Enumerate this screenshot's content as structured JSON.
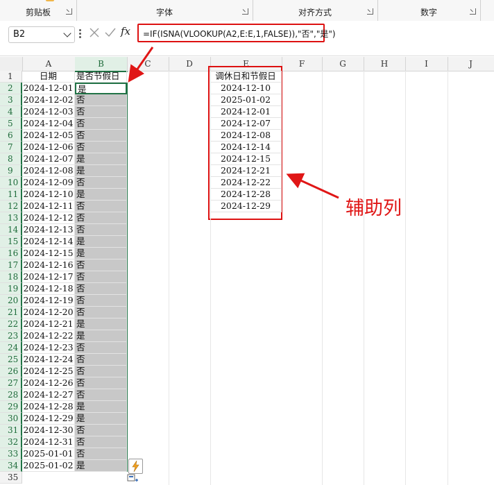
{
  "ribbon": {
    "groups": [
      "剪贴板",
      "字体",
      "对齐方式",
      "数字"
    ]
  },
  "formula_bar": {
    "name_box": "B2",
    "formula": "=IF(ISNA(VLOOKUP(A2,E:E,1,FALSE)),\"否\",\"是\")"
  },
  "columns": [
    "A",
    "B",
    "C",
    "D",
    "E",
    "F",
    "G",
    "H",
    "I",
    "J"
  ],
  "rows": [
    "1",
    "2",
    "3",
    "4",
    "5",
    "6",
    "7",
    "8",
    "9",
    "10",
    "11",
    "12",
    "13",
    "14",
    "15",
    "16",
    "17",
    "18",
    "19",
    "20",
    "21",
    "22",
    "23",
    "24",
    "25",
    "26",
    "27",
    "28",
    "29",
    "30",
    "31",
    "32",
    "33",
    "34",
    "35"
  ],
  "sheet": {
    "A": [
      "日期",
      "2024-12-01",
      "2024-12-02",
      "2024-12-03",
      "2024-12-04",
      "2024-12-05",
      "2024-12-06",
      "2024-12-07",
      "2024-12-08",
      "2024-12-09",
      "2024-12-10",
      "2024-12-11",
      "2024-12-12",
      "2024-12-13",
      "2024-12-14",
      "2024-12-15",
      "2024-12-16",
      "2024-12-17",
      "2024-12-18",
      "2024-12-19",
      "2024-12-20",
      "2024-12-21",
      "2024-12-22",
      "2024-12-23",
      "2024-12-24",
      "2024-12-25",
      "2024-12-26",
      "2024-12-27",
      "2024-12-28",
      "2024-12-29",
      "2024-12-30",
      "2024-12-31",
      "2025-01-01",
      "2025-01-02"
    ],
    "B": [
      "是否节假日",
      "是",
      "否",
      "否",
      "否",
      "否",
      "否",
      "是",
      "是",
      "否",
      "是",
      "否",
      "否",
      "否",
      "是",
      "是",
      "否",
      "否",
      "否",
      "否",
      "否",
      "是",
      "是",
      "否",
      "否",
      "否",
      "否",
      "否",
      "是",
      "是",
      "否",
      "否",
      "否",
      "是"
    ],
    "E": [
      "调休日和节假日",
      "2024-12-10",
      "2025-01-02",
      "2024-12-01",
      "2024-12-07",
      "2024-12-08",
      "2024-12-14",
      "2024-12-15",
      "2024-12-21",
      "2024-12-22",
      "2024-12-28",
      "2024-12-29"
    ]
  },
  "annotation": {
    "label": "辅助列",
    "color": "#e01616"
  },
  "colors": {
    "selection": "#217346",
    "highlight": "#d11111",
    "shade": "#c8c8c8"
  }
}
